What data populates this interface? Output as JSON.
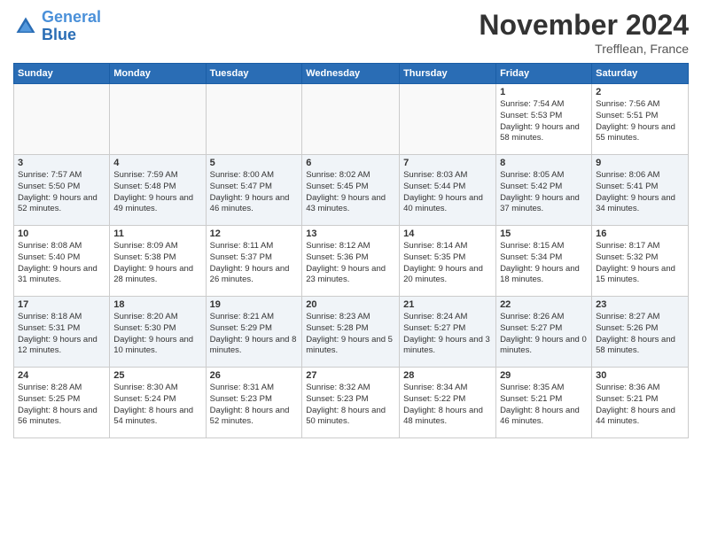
{
  "header": {
    "logo_general": "General",
    "logo_blue": "Blue",
    "month_title": "November 2024",
    "location": "Trefflean, France"
  },
  "weekdays": [
    "Sunday",
    "Monday",
    "Tuesday",
    "Wednesday",
    "Thursday",
    "Friday",
    "Saturday"
  ],
  "weeks": [
    [
      {
        "day": "",
        "info": ""
      },
      {
        "day": "",
        "info": ""
      },
      {
        "day": "",
        "info": ""
      },
      {
        "day": "",
        "info": ""
      },
      {
        "day": "",
        "info": ""
      },
      {
        "day": "1",
        "info": "Sunrise: 7:54 AM\nSunset: 5:53 PM\nDaylight: 9 hours and 58 minutes."
      },
      {
        "day": "2",
        "info": "Sunrise: 7:56 AM\nSunset: 5:51 PM\nDaylight: 9 hours and 55 minutes."
      }
    ],
    [
      {
        "day": "3",
        "info": "Sunrise: 7:57 AM\nSunset: 5:50 PM\nDaylight: 9 hours and 52 minutes."
      },
      {
        "day": "4",
        "info": "Sunrise: 7:59 AM\nSunset: 5:48 PM\nDaylight: 9 hours and 49 minutes."
      },
      {
        "day": "5",
        "info": "Sunrise: 8:00 AM\nSunset: 5:47 PM\nDaylight: 9 hours and 46 minutes."
      },
      {
        "day": "6",
        "info": "Sunrise: 8:02 AM\nSunset: 5:45 PM\nDaylight: 9 hours and 43 minutes."
      },
      {
        "day": "7",
        "info": "Sunrise: 8:03 AM\nSunset: 5:44 PM\nDaylight: 9 hours and 40 minutes."
      },
      {
        "day": "8",
        "info": "Sunrise: 8:05 AM\nSunset: 5:42 PM\nDaylight: 9 hours and 37 minutes."
      },
      {
        "day": "9",
        "info": "Sunrise: 8:06 AM\nSunset: 5:41 PM\nDaylight: 9 hours and 34 minutes."
      }
    ],
    [
      {
        "day": "10",
        "info": "Sunrise: 8:08 AM\nSunset: 5:40 PM\nDaylight: 9 hours and 31 minutes."
      },
      {
        "day": "11",
        "info": "Sunrise: 8:09 AM\nSunset: 5:38 PM\nDaylight: 9 hours and 28 minutes."
      },
      {
        "day": "12",
        "info": "Sunrise: 8:11 AM\nSunset: 5:37 PM\nDaylight: 9 hours and 26 minutes."
      },
      {
        "day": "13",
        "info": "Sunrise: 8:12 AM\nSunset: 5:36 PM\nDaylight: 9 hours and 23 minutes."
      },
      {
        "day": "14",
        "info": "Sunrise: 8:14 AM\nSunset: 5:35 PM\nDaylight: 9 hours and 20 minutes."
      },
      {
        "day": "15",
        "info": "Sunrise: 8:15 AM\nSunset: 5:34 PM\nDaylight: 9 hours and 18 minutes."
      },
      {
        "day": "16",
        "info": "Sunrise: 8:17 AM\nSunset: 5:32 PM\nDaylight: 9 hours and 15 minutes."
      }
    ],
    [
      {
        "day": "17",
        "info": "Sunrise: 8:18 AM\nSunset: 5:31 PM\nDaylight: 9 hours and 12 minutes."
      },
      {
        "day": "18",
        "info": "Sunrise: 8:20 AM\nSunset: 5:30 PM\nDaylight: 9 hours and 10 minutes."
      },
      {
        "day": "19",
        "info": "Sunrise: 8:21 AM\nSunset: 5:29 PM\nDaylight: 9 hours and 8 minutes."
      },
      {
        "day": "20",
        "info": "Sunrise: 8:23 AM\nSunset: 5:28 PM\nDaylight: 9 hours and 5 minutes."
      },
      {
        "day": "21",
        "info": "Sunrise: 8:24 AM\nSunset: 5:27 PM\nDaylight: 9 hours and 3 minutes."
      },
      {
        "day": "22",
        "info": "Sunrise: 8:26 AM\nSunset: 5:27 PM\nDaylight: 9 hours and 0 minutes."
      },
      {
        "day": "23",
        "info": "Sunrise: 8:27 AM\nSunset: 5:26 PM\nDaylight: 8 hours and 58 minutes."
      }
    ],
    [
      {
        "day": "24",
        "info": "Sunrise: 8:28 AM\nSunset: 5:25 PM\nDaylight: 8 hours and 56 minutes."
      },
      {
        "day": "25",
        "info": "Sunrise: 8:30 AM\nSunset: 5:24 PM\nDaylight: 8 hours and 54 minutes."
      },
      {
        "day": "26",
        "info": "Sunrise: 8:31 AM\nSunset: 5:23 PM\nDaylight: 8 hours and 52 minutes."
      },
      {
        "day": "27",
        "info": "Sunrise: 8:32 AM\nSunset: 5:23 PM\nDaylight: 8 hours and 50 minutes."
      },
      {
        "day": "28",
        "info": "Sunrise: 8:34 AM\nSunset: 5:22 PM\nDaylight: 8 hours and 48 minutes."
      },
      {
        "day": "29",
        "info": "Sunrise: 8:35 AM\nSunset: 5:21 PM\nDaylight: 8 hours and 46 minutes."
      },
      {
        "day": "30",
        "info": "Sunrise: 8:36 AM\nSunset: 5:21 PM\nDaylight: 8 hours and 44 minutes."
      }
    ]
  ]
}
